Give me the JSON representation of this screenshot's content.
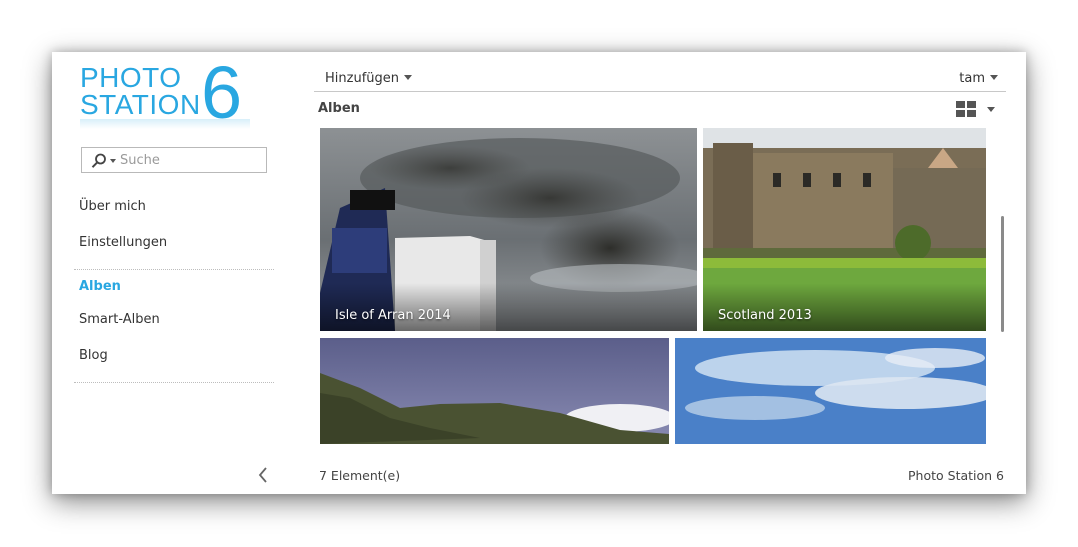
{
  "app": {
    "logo_line1": "PHOTO",
    "logo_line2": "STATION",
    "logo_number": "6",
    "brand_color": "#29a7e1"
  },
  "search": {
    "placeholder": "Suche",
    "icon": "search-icon"
  },
  "sidebar": {
    "items": [
      {
        "label": "Über mich"
      },
      {
        "label": "Einstellungen"
      },
      {
        "label": "Alben",
        "active": true
      },
      {
        "label": "Smart-Alben"
      },
      {
        "label": "Blog"
      }
    ],
    "collapse_icon": "chevron-left-icon"
  },
  "toolbar": {
    "add_label": "Hinzufügen",
    "user_label": "tam",
    "view_icon": "grid-view-icon"
  },
  "section": {
    "title": "Alben"
  },
  "albums": [
    {
      "title": "Isle of Arran 2014"
    },
    {
      "title": "Scotland 2013"
    },
    {
      "title": ""
    },
    {
      "title": ""
    }
  ],
  "footer": {
    "count": "7 Element(e)",
    "brand": "Photo Station 6"
  }
}
